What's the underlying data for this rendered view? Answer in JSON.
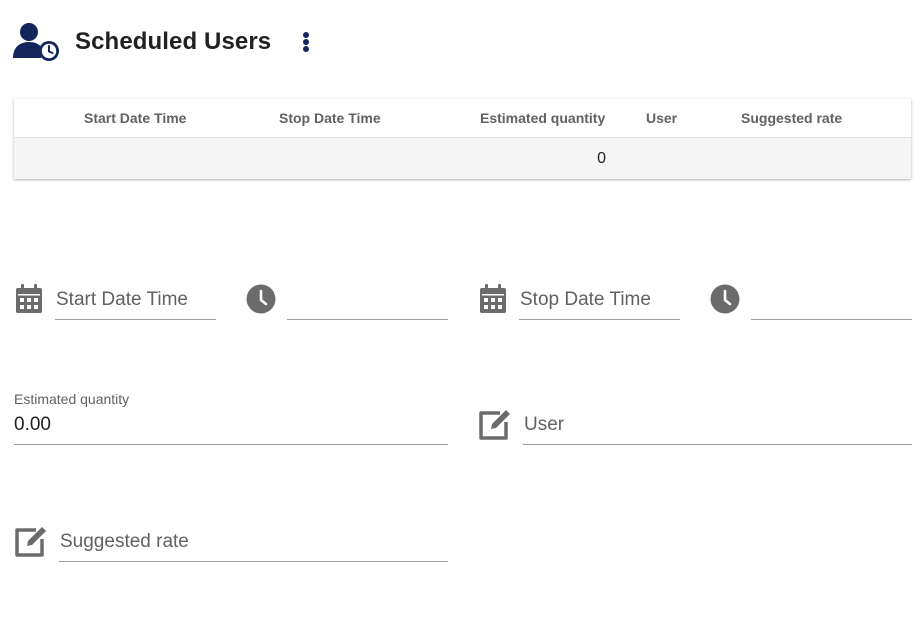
{
  "header": {
    "title": "Scheduled Users",
    "icon": "user-clock-icon",
    "menu_icon": "more-vert-icon",
    "accent_color": "#13265c"
  },
  "table": {
    "columns": [
      "Start Date Time",
      "Stop Date Time",
      "Estimated quantity",
      "User",
      "Suggested rate"
    ],
    "rows": [
      {
        "start": "",
        "stop": "",
        "estimated_quantity": "0",
        "user": "",
        "suggested_rate": ""
      }
    ]
  },
  "form": {
    "start_date": {
      "placeholder": "Start Date Time",
      "icon": "calendar-icon"
    },
    "start_time": {
      "placeholder": "",
      "icon": "clock-icon"
    },
    "stop_date": {
      "placeholder": "Stop Date Time",
      "icon": "calendar-icon"
    },
    "stop_time": {
      "placeholder": "",
      "icon": "clock-icon"
    },
    "estimated_quantity": {
      "label": "Estimated quantity",
      "value": "0.00"
    },
    "user": {
      "placeholder": "User",
      "icon": "edit-icon"
    },
    "suggested_rate": {
      "placeholder": "Suggested rate",
      "icon": "edit-icon"
    }
  }
}
